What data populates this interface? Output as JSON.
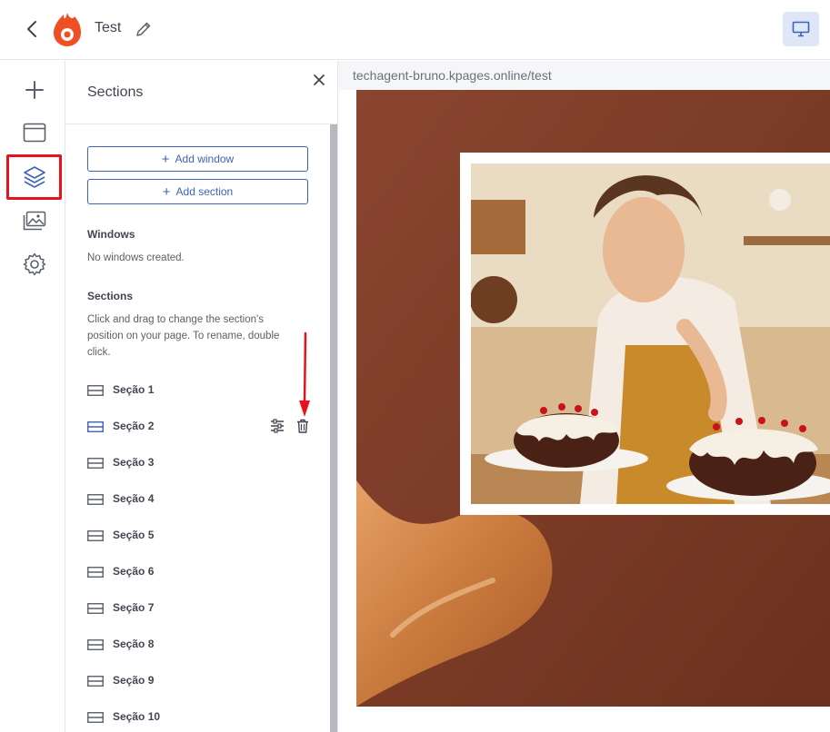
{
  "header": {
    "title": "Test"
  },
  "panel": {
    "title": "Sections",
    "add_window_label": "Add window",
    "add_section_label": "Add section",
    "windows_heading": "Windows",
    "windows_empty": "No windows created.",
    "sections_heading": "Sections",
    "sections_help": "Click and drag to change the section's position on your page. To rename, double click.",
    "sections": [
      {
        "label": "Seção 1"
      },
      {
        "label": "Seção 2"
      },
      {
        "label": "Seção 3"
      },
      {
        "label": "Seção 4"
      },
      {
        "label": "Seção 5"
      },
      {
        "label": "Seção 6"
      },
      {
        "label": "Seção 7"
      },
      {
        "label": "Seção 8"
      },
      {
        "label": "Seção 9"
      },
      {
        "label": "Seção 10"
      }
    ]
  },
  "preview": {
    "url": "techagent-bruno.kpages.online/test"
  },
  "icons": {
    "back": "chevron-left-icon",
    "logo": "flame-logo",
    "edit": "pencil-icon",
    "device": "desktop-icon",
    "add": "plus-icon",
    "window": "browser-window-icon",
    "layers": "layers-icon",
    "gallery": "image-gallery-icon",
    "settings": "gear-icon",
    "close": "close-icon",
    "section": "section-rows-icon",
    "section_settings": "sliders-icon",
    "delete": "trash-icon"
  },
  "colors": {
    "accent": "#3d63b5",
    "brand": "#f04e23",
    "highlight": "#e8121d",
    "canvas_bg": "#7a3b24"
  }
}
